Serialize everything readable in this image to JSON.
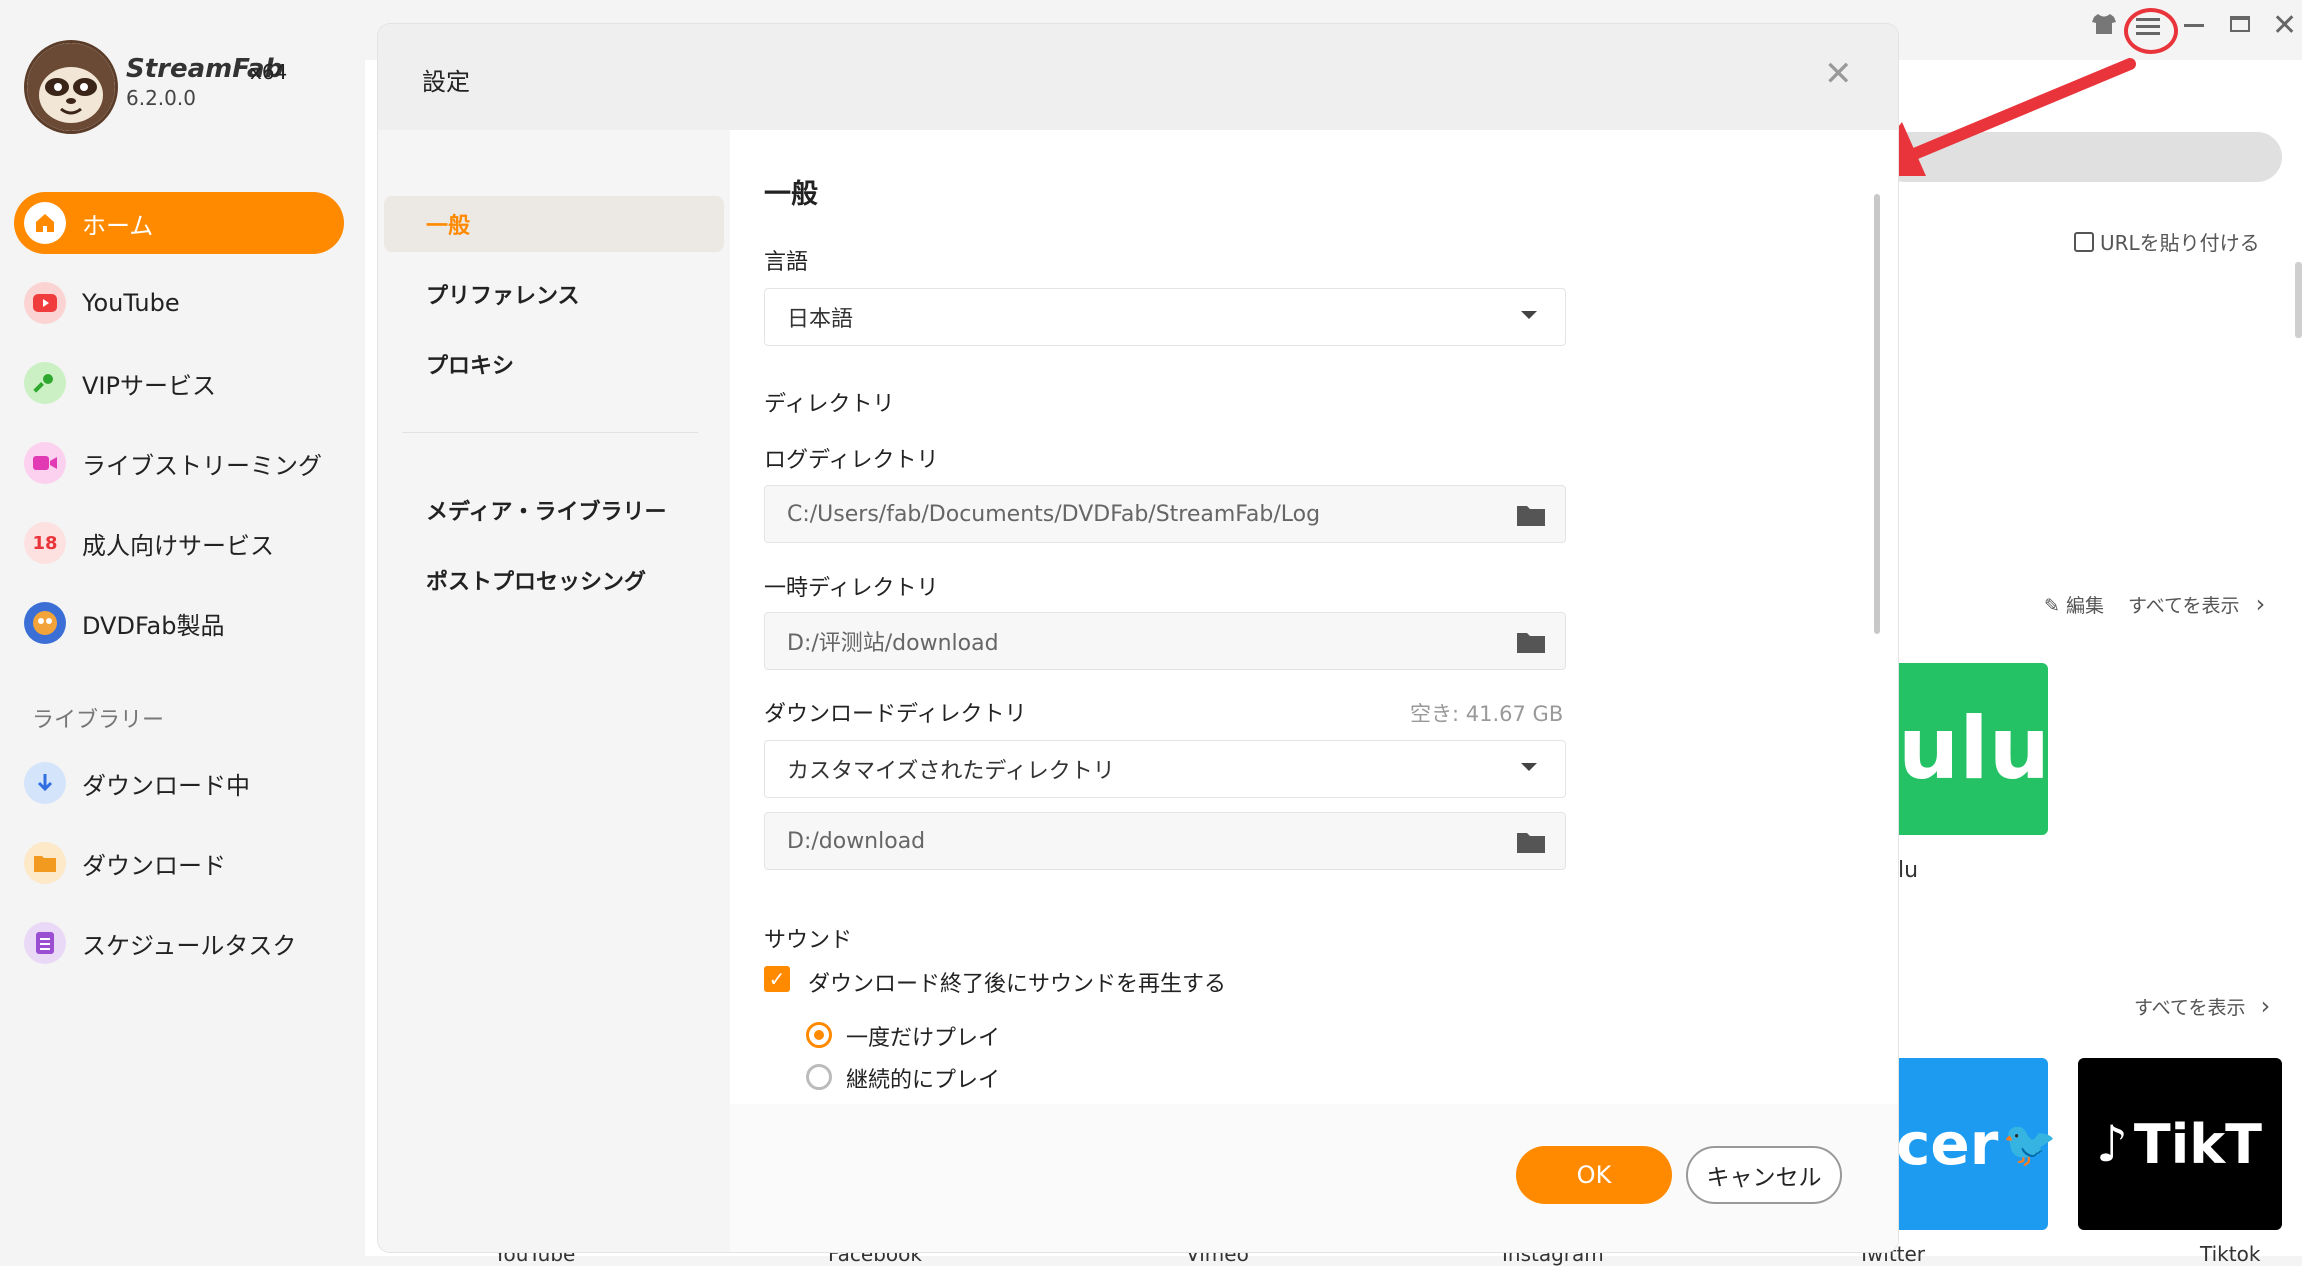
{
  "app": {
    "name": "StreamFab",
    "arch": "x64",
    "version": "6.2.0.0"
  },
  "sidebar": {
    "items": [
      {
        "label": "ホーム"
      },
      {
        "label": "YouTube"
      },
      {
        "label": "VIPサービス"
      },
      {
        "label": "ライブストリーミング"
      },
      {
        "label": "成人向けサービス"
      },
      {
        "label": "DVDFab製品"
      }
    ],
    "library_title": "ライブラリー",
    "library_items": [
      {
        "label": "ダウンロード中"
      },
      {
        "label": "ダウンロード"
      },
      {
        "label": "スケジュールタスク"
      }
    ]
  },
  "background": {
    "paste_url": "URLを貼り付ける",
    "edit": "編集",
    "show_all": "すべてを表示",
    "hulu_tile_text": "ulu",
    "hulu_label": "lu",
    "twitter_tile_text": "cer",
    "tiktok_tile_text": "TikT",
    "bottom_labels": [
      "YouTube",
      "Facebook",
      "Vimeo",
      "Instagram",
      "Twitter",
      "Tiktok"
    ]
  },
  "dialog": {
    "title": "設定",
    "menu": [
      {
        "label": "一般"
      },
      {
        "label": "プリファレンス"
      },
      {
        "label": "プロキシ"
      },
      {
        "label": "メディア・ライブラリー"
      },
      {
        "label": "ポストプロセッシング"
      }
    ],
    "section_title": "一般",
    "language": {
      "label": "言語",
      "value": "日本語"
    },
    "directory": {
      "title": "ディレクトリ",
      "log": {
        "label": "ログディレクトリ",
        "value": "C:/Users/fab/Documents/DVDFab/StreamFab/Log"
      },
      "temp": {
        "label": "一時ディレクトリ",
        "value": "D:/评测站/download"
      },
      "download": {
        "label": "ダウンロードディレクトリ",
        "free": "空き: 41.67 GB",
        "select": "カスタマイズされたディレクトリ",
        "path": "D:/download"
      }
    },
    "sound": {
      "title": "サウンド",
      "checkbox": "ダウンロード終了後にサウンドを再生する",
      "radio1": "一度だけプレイ",
      "radio2": "継続的にプレイ"
    },
    "ok": "OK",
    "cancel": "キャンセル"
  },
  "colors": {
    "accent": "#ff8a00",
    "annotation": "#e8343a"
  }
}
